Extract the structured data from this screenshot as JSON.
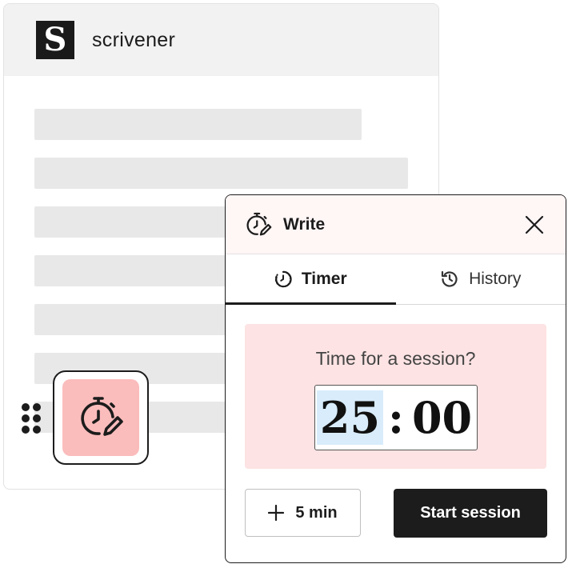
{
  "app": {
    "logo_letter": "S",
    "title": "scrivener"
  },
  "panel": {
    "title": "Write",
    "tabs": [
      {
        "label": "Timer",
        "icon": "timer-icon",
        "active": true
      },
      {
        "label": "History",
        "icon": "history-icon",
        "active": false
      }
    ],
    "session": {
      "prompt": "Time for a session?",
      "minutes": "25",
      "separator": ":",
      "seconds": "00"
    },
    "add_button_label": "5 min",
    "start_button_label": "Start session"
  },
  "colors": {
    "accent_pink": "#fbbcbc",
    "session_bg": "#fde3e3",
    "dark": "#1c1c1c",
    "minutes_highlight": "#d8ecfb"
  }
}
